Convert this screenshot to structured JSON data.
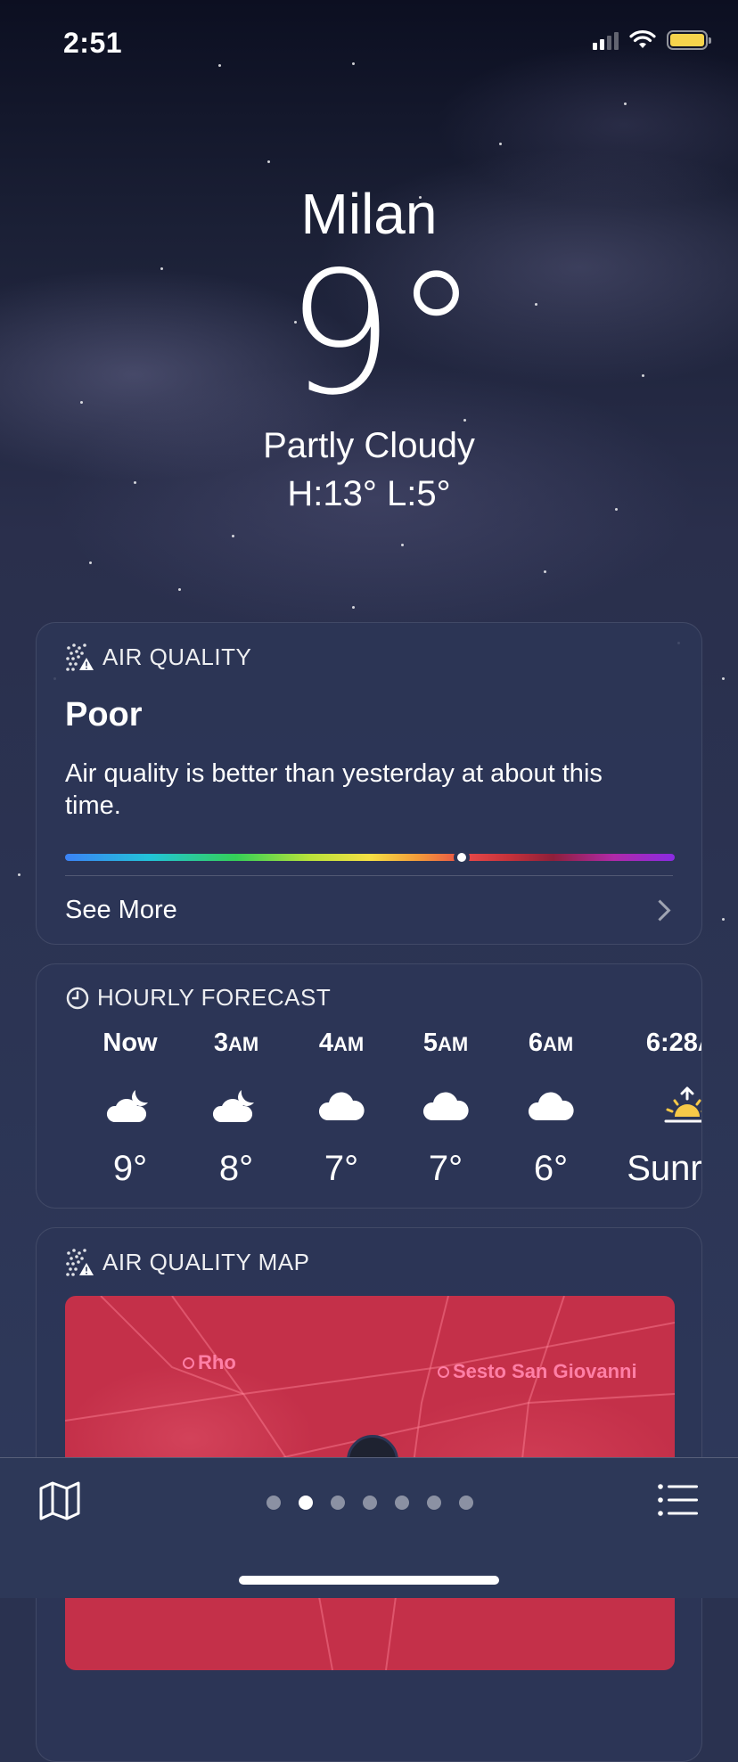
{
  "status": {
    "time": "2:51"
  },
  "header": {
    "city": "Milan",
    "temp": "9°",
    "condition": "Partly Cloudy",
    "high_low": "H:13°  L:5°"
  },
  "air_quality": {
    "title": "AIR QUALITY",
    "level": "Poor",
    "description": "Air quality is better than yesterday at about this time.",
    "index_fraction": 0.65,
    "see_more": "See More"
  },
  "hourly_forecast": {
    "title": "HOURLY FORECAST",
    "items": [
      {
        "time": "Now",
        "suffix": "",
        "icon": "cloud-moon-icon",
        "temp": "9°"
      },
      {
        "time": "3",
        "suffix": "AM",
        "icon": "cloud-moon-icon",
        "temp": "8°"
      },
      {
        "time": "4",
        "suffix": "AM",
        "icon": "cloud-icon",
        "temp": "7°"
      },
      {
        "time": "5",
        "suffix": "AM",
        "icon": "cloud-icon",
        "temp": "7°"
      },
      {
        "time": "6",
        "suffix": "AM",
        "icon": "cloud-icon",
        "temp": "6°"
      },
      {
        "time": "6:28",
        "suffix": "AM",
        "icon": "sunrise-icon",
        "temp": "Sunrise"
      }
    ]
  },
  "air_quality_map": {
    "title": "AIR QUALITY MAP",
    "places": [
      "Rho",
      "Sesto San Giovanni"
    ]
  },
  "tabbar": {
    "page_count": 7,
    "active_page": 2
  },
  "colors": {
    "sunrise": "#f7c948",
    "map_fill": "#c43049",
    "battery": "#f7d44c"
  }
}
